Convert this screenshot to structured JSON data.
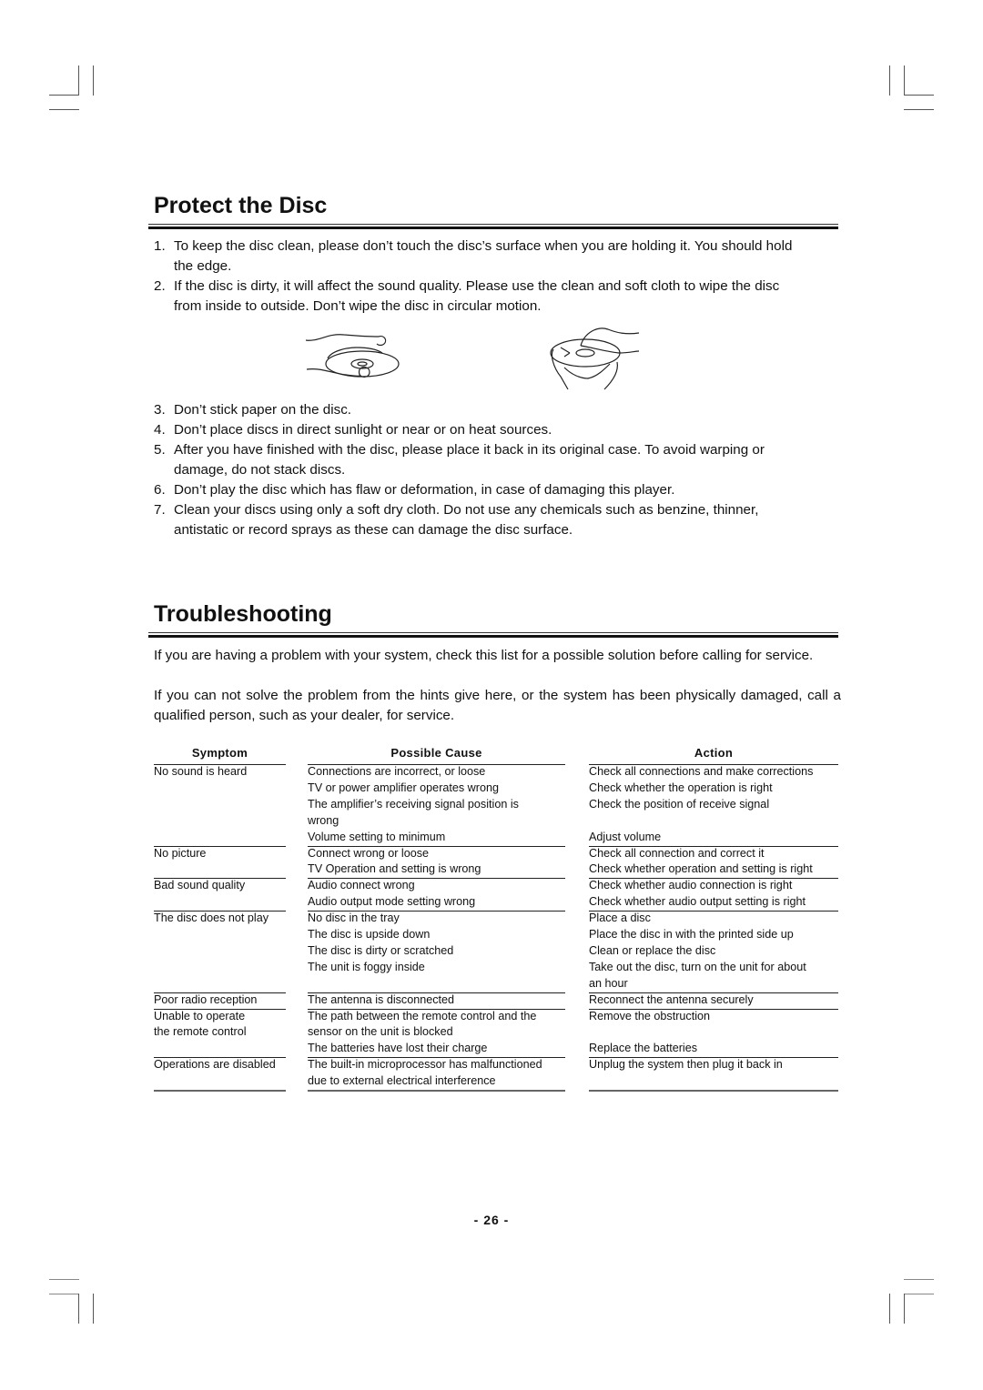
{
  "sections": {
    "protect": {
      "title": "Protect the Disc",
      "items_a": [
        {
          "num": "1.",
          "lines": [
            "To keep the disc clean, please don’t touch the disc’s surface when you are holding it. You should hold",
            "the edge."
          ]
        },
        {
          "num": "2.",
          "lines": [
            "If the disc is dirty, it will affect the sound quality. Please use the clean and soft cloth to wipe the disc",
            "from inside to outside. Don’t wipe the disc in circular motion."
          ]
        }
      ],
      "illustrations": [
        "hand-holding-disc-edge",
        "wiping-disc-with-cloth"
      ],
      "items_b": [
        {
          "num": "3.",
          "lines": [
            "Don’t stick paper on the disc."
          ]
        },
        {
          "num": "4.",
          "lines": [
            "Don’t place discs in direct sunlight or near or on heat sources."
          ]
        },
        {
          "num": "5.",
          "lines": [
            "After you have finished with the disc, please place it back in its original case. To avoid warping or",
            "damage, do not stack discs."
          ]
        },
        {
          "num": "6.",
          "lines": [
            "Don’t play the disc which has flaw or deformation, in case of damaging this player."
          ]
        },
        {
          "num": "7.",
          "lines": [
            "Clean your discs using only a soft dry cloth. Do not use any chemicals such as benzine, thinner,",
            "antistatic or record sprays as these can damage the disc surface."
          ]
        }
      ]
    },
    "troubleshooting": {
      "title": "Troubleshooting",
      "intro": [
        "If you are having a problem with your system, check this list for a possible solution before calling for service.",
        "If you can not solve the problem from the hints give here, or the system has been physically damaged, call a qualified person, such as your dealer, for service."
      ],
      "table": {
        "headers": {
          "symptom": "Symptom",
          "cause": "Possible Cause",
          "action": "Action"
        },
        "rows": [
          {
            "symptom": "No sound is heard",
            "cause": "Connections are incorrect, or loose",
            "action": "Check all connections and make corrections"
          },
          {
            "symptom": "",
            "cause": "TV or power amplifier operates wrong",
            "action": "Check whether the operation is right"
          },
          {
            "symptom": "",
            "cause": "The amplifier’s receiving signal position is",
            "action": "Check the position of receive signal"
          },
          {
            "symptom": "",
            "cause": "wrong",
            "action": ""
          },
          {
            "symptom": "",
            "cause": "Volume setting to minimum",
            "action": "Adjust volume"
          },
          {
            "symptom": "No picture",
            "cause": "Connect wrong or loose",
            "action": "Check all connection and correct it"
          },
          {
            "symptom": "",
            "cause": "TV Operation and setting is wrong",
            "action": "Check whether operation and setting is right"
          },
          {
            "symptom": "Bad sound quality",
            "cause": "Audio connect wrong",
            "action": "Check whether audio connection is right"
          },
          {
            "symptom": "",
            "cause": "Audio output mode setting wrong",
            "action": "Check whether audio output setting is right"
          },
          {
            "symptom": "The disc does not play",
            "cause": "No disc in the tray",
            "action": "Place a disc"
          },
          {
            "symptom": "",
            "cause": "The disc is upside down",
            "action": "Place the disc in with the printed side up"
          },
          {
            "symptom": "",
            "cause": "The disc is dirty or scratched",
            "action": "Clean or replace the disc"
          },
          {
            "symptom": "",
            "cause": "The unit is foggy inside",
            "action": "Take out the disc, turn on the unit for about"
          },
          {
            "symptom": "",
            "cause": "",
            "action": "an hour"
          },
          {
            "symptom": "Poor radio reception",
            "cause": "The antenna is disconnected",
            "action": "Reconnect the antenna securely"
          },
          {
            "symptom": "Unable to operate",
            "cause": "The path between the remote control and the",
            "action": "Remove the obstruction"
          },
          {
            "symptom": "the remote control",
            "cause": "sensor on the unit is blocked",
            "action": ""
          },
          {
            "symptom": "",
            "cause": "The batteries have lost their charge",
            "action": "Replace the batteries"
          },
          {
            "symptom": "Operations are disabled",
            "cause": "The built-in microprocessor has malfunctioned",
            "action": "Unplug the system then plug it back in"
          },
          {
            "symptom": "",
            "cause": "due to external electrical interference",
            "action": ""
          }
        ]
      }
    }
  },
  "footer": {
    "page_number": "- 26 -"
  }
}
